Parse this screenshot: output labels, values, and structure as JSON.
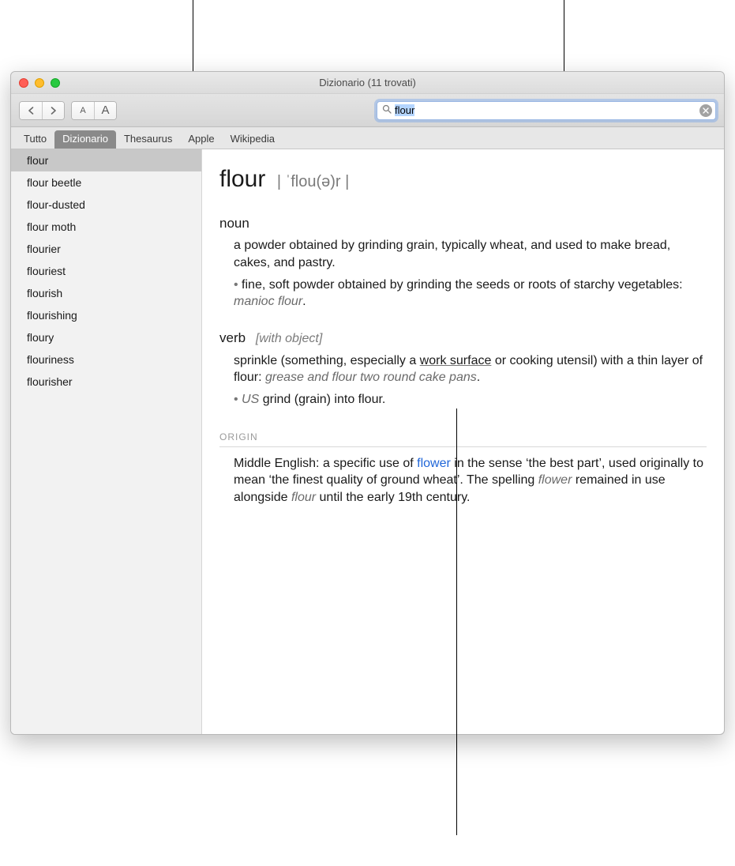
{
  "window": {
    "title": "Dizionario (11 trovati)"
  },
  "toolbar": {
    "back_label": "‹",
    "forward_label": "›",
    "font_small": "A",
    "font_large": "A"
  },
  "search": {
    "value": "flour",
    "placeholder": ""
  },
  "tabs": [
    {
      "label": "Tutto"
    },
    {
      "label": "Dizionario",
      "active": true
    },
    {
      "label": "Thesaurus"
    },
    {
      "label": "Apple"
    },
    {
      "label": "Wikipedia"
    }
  ],
  "sidebar": {
    "items": [
      "flour",
      "flour beetle",
      "flour-dusted",
      "flour moth",
      "flourier",
      "flouriest",
      "flourish",
      "flourishing",
      "floury",
      "flouriness",
      "flourisher"
    ],
    "selected_index": 0
  },
  "entry": {
    "headword": "flour",
    "pronunciation": "| ˈflou(ə)r |",
    "noun": {
      "label": "noun",
      "def": "a powder obtained by grinding grain, typically wheat, and used to make bread, cakes, and pastry.",
      "sub_def": "fine, soft powder obtained by grinding the seeds or roots of starchy vegetables: ",
      "sub_example": "manioc flour",
      "sub_trail": "."
    },
    "verb": {
      "label": "verb",
      "meta": "[with object]",
      "def_pre": "sprinkle (something, especially a ",
      "def_link": "work surface",
      "def_post": " or cooking utensil) with a thin layer of flour: ",
      "example": "grease and flour two round cake pans",
      "example_trail": ".",
      "sub_region": "US",
      "sub_def": " grind (grain) into flour."
    },
    "origin": {
      "label": "ORIGIN",
      "pre": "Middle English: a specific use of ",
      "link": "flower",
      "mid": " in the sense ‘the best part’, used originally to mean ‘the finest quality of ground wheat’. The spelling ",
      "ital1": "flower",
      "mid2": " remained in use alongside ",
      "ital2": "flour",
      "post": " until the early 19th century."
    }
  }
}
